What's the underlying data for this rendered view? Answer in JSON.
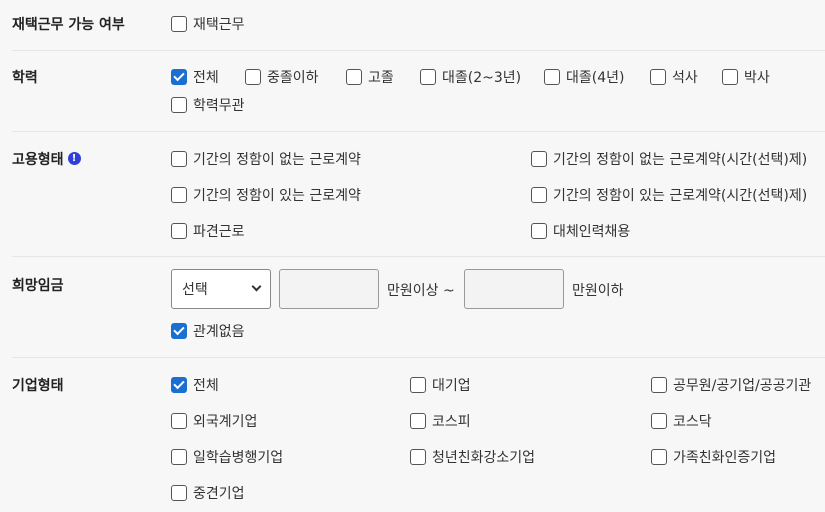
{
  "remote_work": {
    "label": "재택근무 가능 여부",
    "options": [
      {
        "label": "재택근무",
        "checked": false
      }
    ]
  },
  "education": {
    "label": "학력",
    "options": [
      {
        "label": "전체",
        "checked": true
      },
      {
        "label": "중졸이하",
        "checked": false
      },
      {
        "label": "고졸",
        "checked": false
      },
      {
        "label": "대졸(2~3년)",
        "checked": false
      },
      {
        "label": "대졸(4년)",
        "checked": false
      },
      {
        "label": "석사",
        "checked": false
      },
      {
        "label": "박사",
        "checked": false
      },
      {
        "label": "학력무관",
        "checked": false
      }
    ]
  },
  "employment_type": {
    "label": "고용형태",
    "info_icon": "!",
    "options": [
      {
        "label": "기간의 정함이 없는 근로계약",
        "checked": false
      },
      {
        "label": "기간의 정함이 없는 근로계약(시간(선택)제)",
        "checked": false
      },
      {
        "label": "기간의 정함이 있는 근로계약",
        "checked": false
      },
      {
        "label": "기간의 정함이 있는 근로계약(시간(선택)제)",
        "checked": false
      },
      {
        "label": "파견근로",
        "checked": false
      },
      {
        "label": "대체인력채용",
        "checked": false
      }
    ]
  },
  "salary": {
    "label": "희망임금",
    "select_value": "선택",
    "min_value": "",
    "min_suffix": "만원이상 ~",
    "max_value": "",
    "max_suffix": "만원이하",
    "no_matter": {
      "label": "관계없음",
      "checked": true
    }
  },
  "company_type": {
    "label": "기업형태",
    "options": [
      {
        "label": "전체",
        "checked": true
      },
      {
        "label": "대기업",
        "checked": false
      },
      {
        "label": "공무원/공기업/공공기관",
        "checked": false
      },
      {
        "label": "외국계기업",
        "checked": false
      },
      {
        "label": "코스피",
        "checked": false
      },
      {
        "label": "코스닥",
        "checked": false
      },
      {
        "label": "일학습병행기업",
        "checked": false
      },
      {
        "label": "청년친화강소기업",
        "checked": false
      },
      {
        "label": "가족친화인증기업",
        "checked": false
      },
      {
        "label": "중견기업",
        "checked": false
      }
    ]
  },
  "colors": {
    "accent": "#1a6fd1",
    "info": "#2f3fd8",
    "divider": "#e6e6e6"
  }
}
